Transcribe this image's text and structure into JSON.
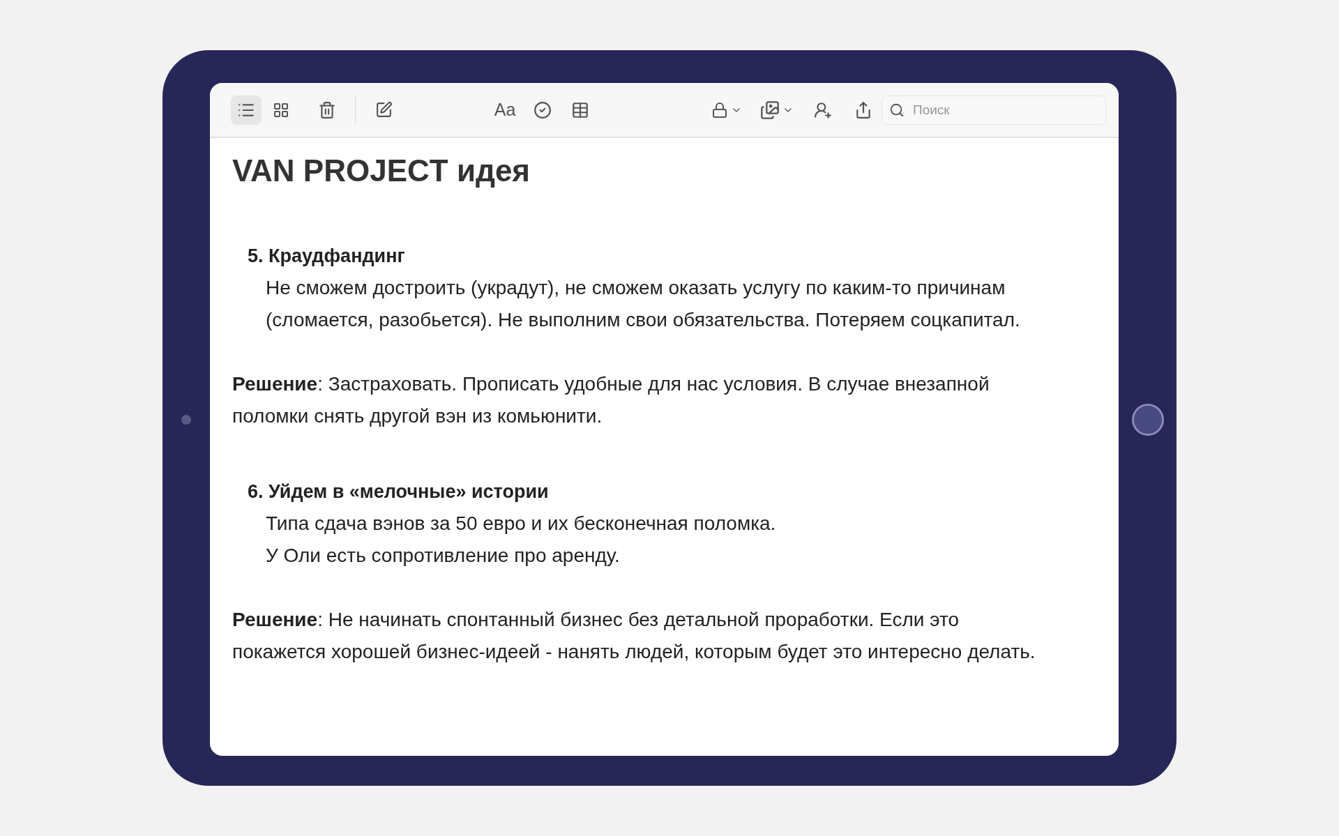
{
  "toolbar": {
    "view_buttons": [
      {
        "kind": "list",
        "selected": true
      },
      {
        "kind": "grid",
        "selected": false
      }
    ],
    "format_label": "Aa",
    "search": {
      "placeholder": "Поиск"
    }
  },
  "note": {
    "title": "VAN PROJECT идея",
    "sections": [
      {
        "heading": "5. Краудфандинг",
        "lines": [
          "Не сможем достроить (украдут), не сможем оказать услугу по каким-то причинам",
          "(сломается, разобьется). Не выполним свои обязательства. Потеряем соцкапитал."
        ],
        "solution": [
          "**Решение**: Застраховать. Прописать удобные для нас условия. В случае внезапной",
          "поломки снять другой вэн из комьюнити."
        ]
      },
      {
        "heading": "6. Уйдем в «мелочные» истории",
        "lines": [
          "Типа сдача вэнов за 50 евро и их бесконечная поломка.",
          "У Оли есть сопротивление про аренду."
        ],
        "solution": [
          "**Решение**: Не начинать спонтанный бизнес без детальной проработки. Если это",
          "покажется хорошей бизнес-идеей - нанять людей, которым будет это интересно делать."
        ]
      }
    ]
  }
}
